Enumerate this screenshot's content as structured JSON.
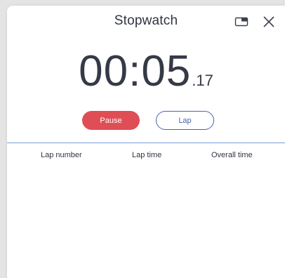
{
  "window": {
    "title": "Stopwatch"
  },
  "controls": {
    "pip_icon": "picture-in-picture-icon",
    "close_icon": "close-icon"
  },
  "timer": {
    "main": "00:05",
    "centiseconds": ".17"
  },
  "buttons": {
    "pause_label": "Pause",
    "lap_label": "Lap"
  },
  "laps": {
    "columns": [
      "Lap number",
      "Lap time",
      "Overall time"
    ],
    "rows": []
  },
  "colors": {
    "pause": "#e04e55",
    "lap_accent": "#4a65a8",
    "divider": "#7a9ad6",
    "text": "#2f3440"
  }
}
